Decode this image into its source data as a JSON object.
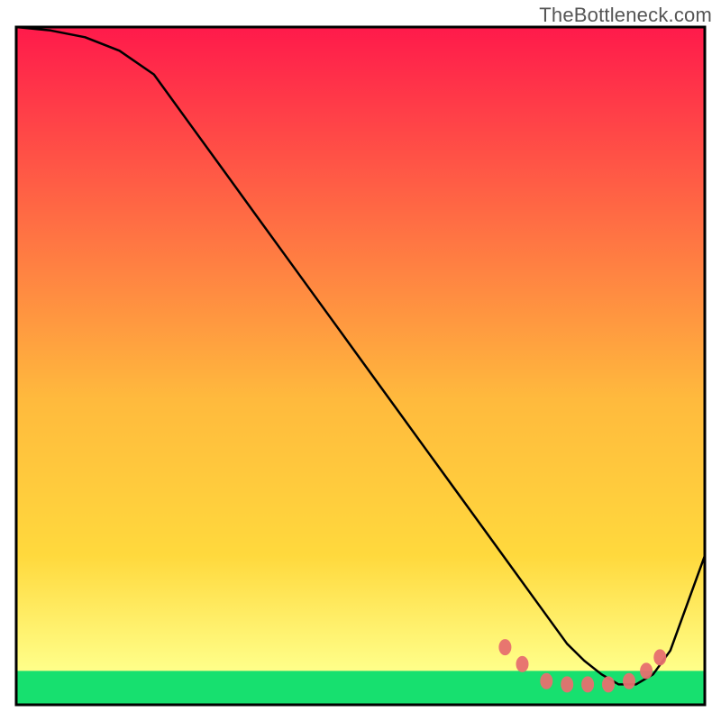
{
  "watermark": "TheBottleneck.com",
  "chart_data": {
    "type": "line",
    "title": "",
    "xlabel": "",
    "ylabel": "",
    "xlim": [
      0,
      100
    ],
    "ylim": [
      0,
      100
    ],
    "background_gradient": {
      "top": "#ff1a4b",
      "mid": "#ffd93d",
      "bottom": "#ffff8a",
      "band": "#17e06f"
    },
    "bottleneck_band_y": [
      0,
      5
    ],
    "series": [
      {
        "name": "bottleneck-curve",
        "color": "#000000",
        "x": [
          0,
          5,
          10,
          15,
          20,
          25,
          30,
          35,
          40,
          45,
          50,
          55,
          60,
          65,
          70,
          75,
          80,
          82.5,
          85,
          87.5,
          90,
          92.5,
          95,
          100
        ],
        "y": [
          100,
          99.5,
          98.5,
          96.5,
          93,
          86,
          79,
          72,
          65,
          58,
          51,
          44,
          37,
          30,
          23,
          16,
          9,
          6.5,
          4.5,
          3,
          3,
          4.5,
          8,
          22
        ]
      }
    ],
    "markers": {
      "name": "curve-dots",
      "color": "#e76f6f",
      "x": [
        71,
        73.5,
        77,
        80,
        83,
        86,
        89,
        91.5,
        93.5
      ],
      "y": [
        8.5,
        6.0,
        3.5,
        3.0,
        3.0,
        3.0,
        3.5,
        5.0,
        7.0
      ]
    }
  }
}
